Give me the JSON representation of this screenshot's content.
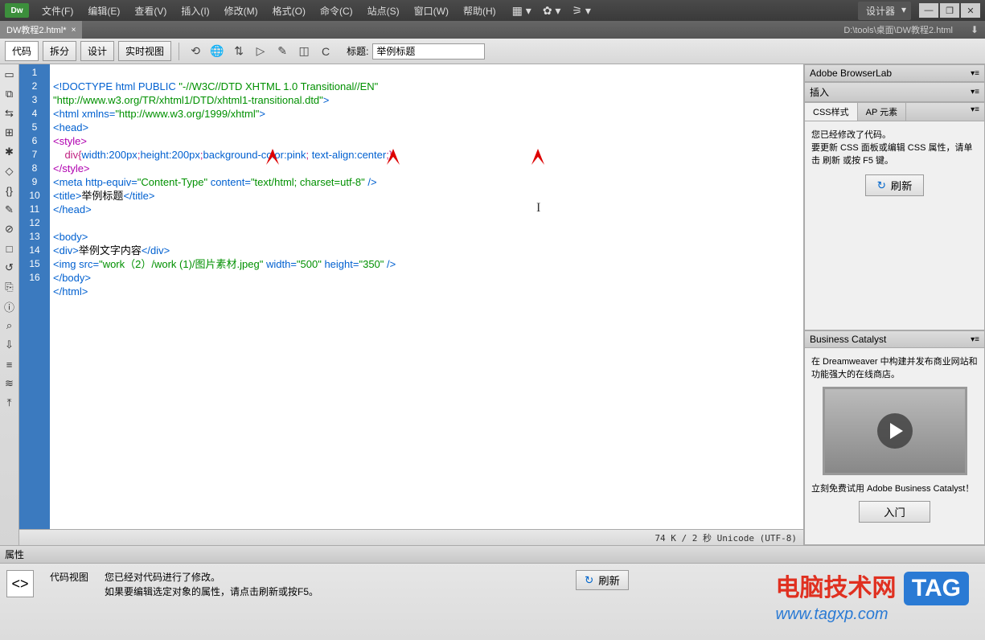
{
  "titlebar": {
    "logo": "Dw",
    "menus": [
      "文件(F)",
      "编辑(E)",
      "查看(V)",
      "插入(I)",
      "修改(M)",
      "格式(O)",
      "命令(C)",
      "站点(S)",
      "窗口(W)",
      "帮助(H)"
    ],
    "designer": "设计器",
    "win": {
      "min": "—",
      "max": "❐",
      "close": "✕"
    }
  },
  "doctab": {
    "name": "DW教程2.html*",
    "close": "×",
    "filepath": "D:\\tools\\桌面\\DW教程2.html",
    "icon": "⬇"
  },
  "toolbar": {
    "code": "代码",
    "split": "拆分",
    "design": "设计",
    "live": "实时视图",
    "title_label": "标题:",
    "title_value": "举例标题",
    "icons": [
      "⟲",
      "🌐",
      "⇅",
      "▷",
      "✎",
      "◫",
      "C"
    ]
  },
  "lefttools": [
    "▭",
    "⧉",
    "⇆",
    "⊞",
    "✱",
    "◇",
    "{}",
    "✎",
    "⊘",
    "□",
    "↺",
    "⎘",
    "ⓘ",
    "⌕",
    "⇩",
    "≡",
    "≋",
    "⤒"
  ],
  "code": {
    "lines": [
      "1",
      "2",
      "3",
      "4",
      "5",
      "6",
      "7",
      "8",
      "9",
      "10",
      "11",
      "12",
      "13",
      "14",
      "15",
      "16"
    ],
    "l1a": "<!DOCTYPE html PUBLIC ",
    "l1b": "\"-//W3C//DTD XHTML 1.0 Transitional//EN\"",
    "l1c": "\"http://www.w3.org/TR/xhtml1/DTD/xhtml1-transitional.dtd\"",
    "l1d": ">",
    "l2a": "<html ",
    "l2b": "xmlns=",
    "l2c": "\"http://www.w3.org/1999/xhtml\"",
    "l2d": ">",
    "l3": "<head>",
    "l4": "<style>",
    "l5a": "    div",
    "l5b": "{",
    "l5c": "width:",
    "l5d": "200px",
    "l5e": ";",
    "l5f": "height:",
    "l5g": "200px",
    "l5h": ";",
    "l5i": "background-color:",
    "l5j": "pink",
    "l5k": "; ",
    "l5l": "text-align:",
    "l5m": "center",
    "l5n": ";}",
    "l6": "</style>",
    "l7a": "<meta ",
    "l7b": "http-equiv=",
    "l7c": "\"Content-Type\"",
    "l7d": " content=",
    "l7e": "\"text/html; charset=utf-8\"",
    "l7f": " />",
    "l8a": "<title>",
    "l8b": "举例标题",
    "l8c": "</title>",
    "l9": "</head>",
    "l11": "<body>",
    "l12a": "<div>",
    "l12b": "举例文字内容",
    "l12c": "</div>",
    "l13a": "<img ",
    "l13b": "src=",
    "l13c": "\"work（2）/work (1)/图片素材.jpeg\"",
    "l13d": " width=",
    "l13e": "\"500\"",
    "l13f": " height=",
    "l13g": "\"350\"",
    "l13h": " />",
    "l14": "</body>",
    "l15": "</html>"
  },
  "status": {
    "right": "74 K / 2 秒 Unicode (UTF-8)"
  },
  "panels": {
    "browserlab": "Adobe BrowserLab",
    "insert": "插入",
    "css_tab": "CSS样式",
    "ap_tab": "AP 元素",
    "css_msg1": "您已经修改了代码。",
    "css_msg2": "要更新 CSS 面板或编辑 CSS 属性，请单击 刷新 或按 F5 键。",
    "refresh_icon": "↻",
    "refresh": "刷新",
    "bc_title": "Business Catalyst",
    "bc_msg": "在 Dreamweaver 中构建并发布商业网站和功能强大的在线商店。",
    "bc_cta": "立刻免费试用 Adobe Business Catalyst！",
    "bc_enter": "入门"
  },
  "props": {
    "title": "属性",
    "icon": "<>",
    "label": "代码视图",
    "msg1": "您已经对代码进行了修改。",
    "msg2": "如果要编辑选定对象的属性，请点击刷新或按F5。",
    "refresh_icon": "↻",
    "refresh": "刷新"
  },
  "watermark": {
    "text": "电脑技术网",
    "tag": "TAG",
    "url": "www.tagxp.com"
  }
}
